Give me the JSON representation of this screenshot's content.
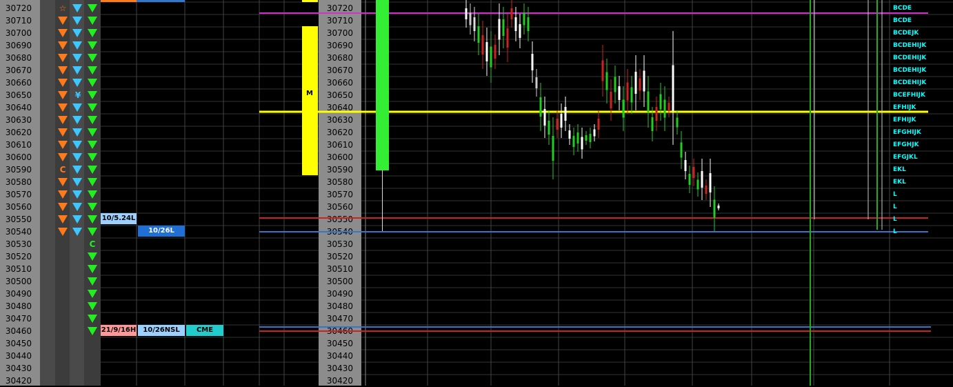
{
  "prices": [
    "30720",
    "30710",
    "30700",
    "30690",
    "30680",
    "30670",
    "30660",
    "30650",
    "30640",
    "30630",
    "30620",
    "30610",
    "30600",
    "30590",
    "30580",
    "30570",
    "30560",
    "30550",
    "30540",
    "30530",
    "30520",
    "30510",
    "30500",
    "30490",
    "30480",
    "30470",
    "30460",
    "30450",
    "30440",
    "30430",
    "30420"
  ],
  "col1_markers": [
    {
      "row": 0,
      "type": "star",
      "text": "☆"
    },
    {
      "row": 13,
      "type": "letter",
      "text": "C"
    }
  ],
  "col2_markers": [
    {
      "row": 7,
      "type": "letter",
      "text": "¥"
    }
  ],
  "col3_markers": [
    {
      "row": 19,
      "type": "letter",
      "text": "C"
    }
  ],
  "profile_bar": {
    "label": "M"
  },
  "tags": {
    "left_row17": "10/5.24L",
    "left_row18": "10/26L",
    "bottom_1": "21/9/16H",
    "bottom_2": "10/26NSL",
    "bottom_3": "CME"
  },
  "tpo_letters": [
    "BCDE",
    "BCDE",
    "BCDEJK",
    "BCDEHIJK",
    "BCDEHIJK",
    "BCDEHIJK",
    "BCDEHIJK",
    "BCEFHIJK",
    "EFHIJK",
    "EFHIJK",
    "EFGHIJK",
    "EFGHJK",
    "EFGJKL",
    "EKL",
    "EKL",
    "L",
    "L",
    "L",
    "L"
  ],
  "colors": {
    "label_bg": "#8c8c8c",
    "grid": "#3a3a3a",
    "magenta": "#cc33cc",
    "yellow": "#ffff00",
    "red": "#cc2222",
    "blue": "#3377cc",
    "green_bar": "#33ee33",
    "orange": "#ff7a1a",
    "cyan": "#3ec6ff"
  }
}
